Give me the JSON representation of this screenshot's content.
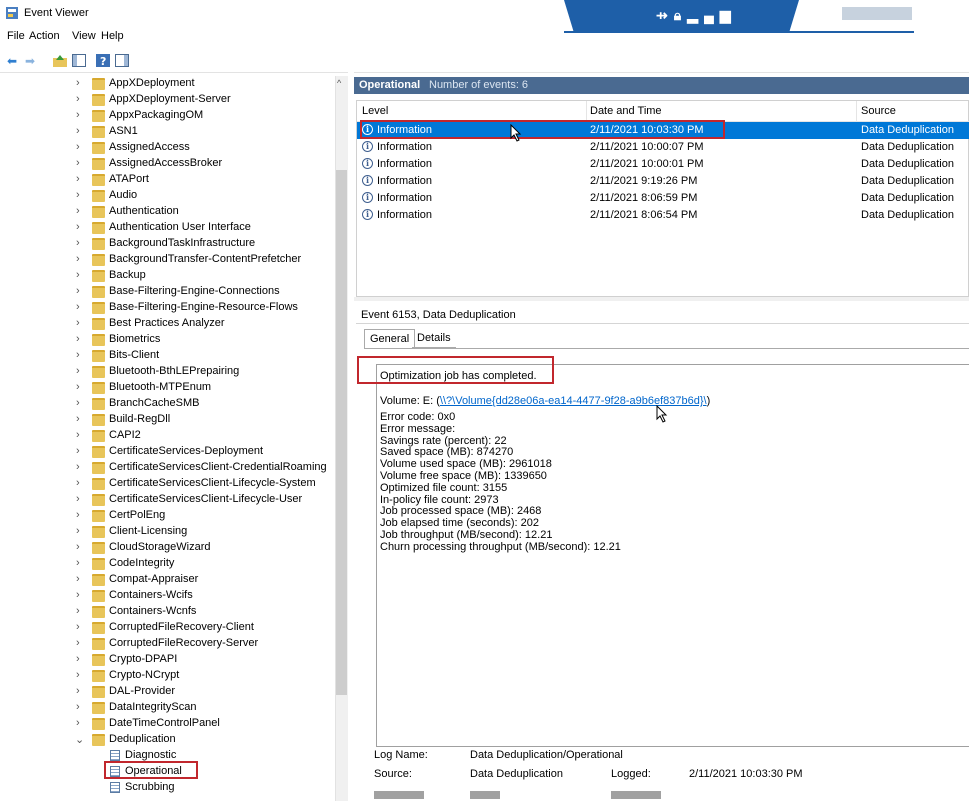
{
  "window": {
    "title": "Event Viewer",
    "app_icon": "event-viewer-icon"
  },
  "menu": [
    "File",
    "Action",
    "View",
    "Help"
  ],
  "toolbar": {
    "icons": [
      "back-arrow-icon",
      "forward-arrow-icon",
      "folder-up-icon",
      "show-hide-tree-icon",
      "help-icon",
      "show-hide-action-pane-icon"
    ]
  },
  "tree": {
    "items": [
      "AppXDeployment",
      "AppXDeployment-Server",
      "AppxPackagingOM",
      "ASN1",
      "AssignedAccess",
      "AssignedAccessBroker",
      "ATAPort",
      "Audio",
      "Authentication",
      "Authentication User Interface",
      "BackgroundTaskInfrastructure",
      "BackgroundTransfer-ContentPrefetcher",
      "Backup",
      "Base-Filtering-Engine-Connections",
      "Base-Filtering-Engine-Resource-Flows",
      "Best Practices Analyzer",
      "Biometrics",
      "Bits-Client",
      "Bluetooth-BthLEPrepairing",
      "Bluetooth-MTPEnum",
      "BranchCacheSMB",
      "Build-RegDll",
      "CAPI2",
      "CertificateServices-Deployment",
      "CertificateServicesClient-CredentialRoaming",
      "CertificateServicesClient-Lifecycle-System",
      "CertificateServicesClient-Lifecycle-User",
      "CertPolEng",
      "Client-Licensing",
      "CloudStorageWizard",
      "CodeIntegrity",
      "Compat-Appraiser",
      "Containers-Wcifs",
      "Containers-Wcnfs",
      "CorruptedFileRecovery-Client",
      "CorruptedFileRecovery-Server",
      "Crypto-DPAPI",
      "Crypto-NCrypt",
      "DAL-Provider",
      "DataIntegrityScan",
      "DateTimeControlPanel"
    ],
    "expanded": "Deduplication",
    "children": [
      "Diagnostic",
      "Operational",
      "Scrubbing"
    ],
    "selected_child": "Operational"
  },
  "events_pane": {
    "title": "Operational",
    "count_label": "Number of events: 6",
    "columns": [
      "Level",
      "Date and Time",
      "Source"
    ],
    "rows": [
      {
        "level": "Information",
        "datetime": "2/11/2021 10:03:30 PM",
        "source": "Data Deduplication"
      },
      {
        "level": "Information",
        "datetime": "2/11/2021 10:00:07 PM",
        "source": "Data Deduplication"
      },
      {
        "level": "Information",
        "datetime": "2/11/2021 10:00:01 PM",
        "source": "Data Deduplication"
      },
      {
        "level": "Information",
        "datetime": "2/11/2021 9:19:26 PM",
        "source": "Data Deduplication"
      },
      {
        "level": "Information",
        "datetime": "2/11/2021 8:06:59 PM",
        "source": "Data Deduplication"
      },
      {
        "level": "Information",
        "datetime": "2/11/2021 8:06:54 PM",
        "source": "Data Deduplication"
      }
    ]
  },
  "detail": {
    "title": "Event 6153, Data Deduplication",
    "tabs": [
      "General",
      "Details"
    ],
    "message_first": "Optimization job has completed.",
    "volume_prefix": "Volume: E: (",
    "volume_link": "\\\\?\\Volume{dd28e06a-ea14-4477-9f28-a9b6ef837b6d}\\",
    "volume_suffix": ")",
    "lines": [
      "Error code: 0x0",
      "Error message:",
      "Savings rate (percent): 22",
      "Saved space (MB): 874270",
      "Volume used space (MB): 2961018",
      "Volume free space (MB): 1339650",
      "Optimized file count: 3155",
      "In-policy file count: 2973",
      "Job processed space (MB): 2468",
      "Job elapsed time (seconds): 202",
      "Job throughput (MB/second): 12.21",
      "Churn processing throughput (MB/second): 12.21"
    ],
    "log_name_label": "Log Name:",
    "log_name_value": "Data Deduplication/Operational",
    "source_label": "Source:",
    "source_value": "Data Deduplication",
    "logged_label": "Logged:",
    "logged_value": "2/11/2021 10:03:30 PM"
  },
  "colors": {
    "selection": "#0078d7",
    "header_bar": "#4a6a91",
    "highlight": "#c1272d",
    "remote_bar": "#1e5fa8"
  }
}
